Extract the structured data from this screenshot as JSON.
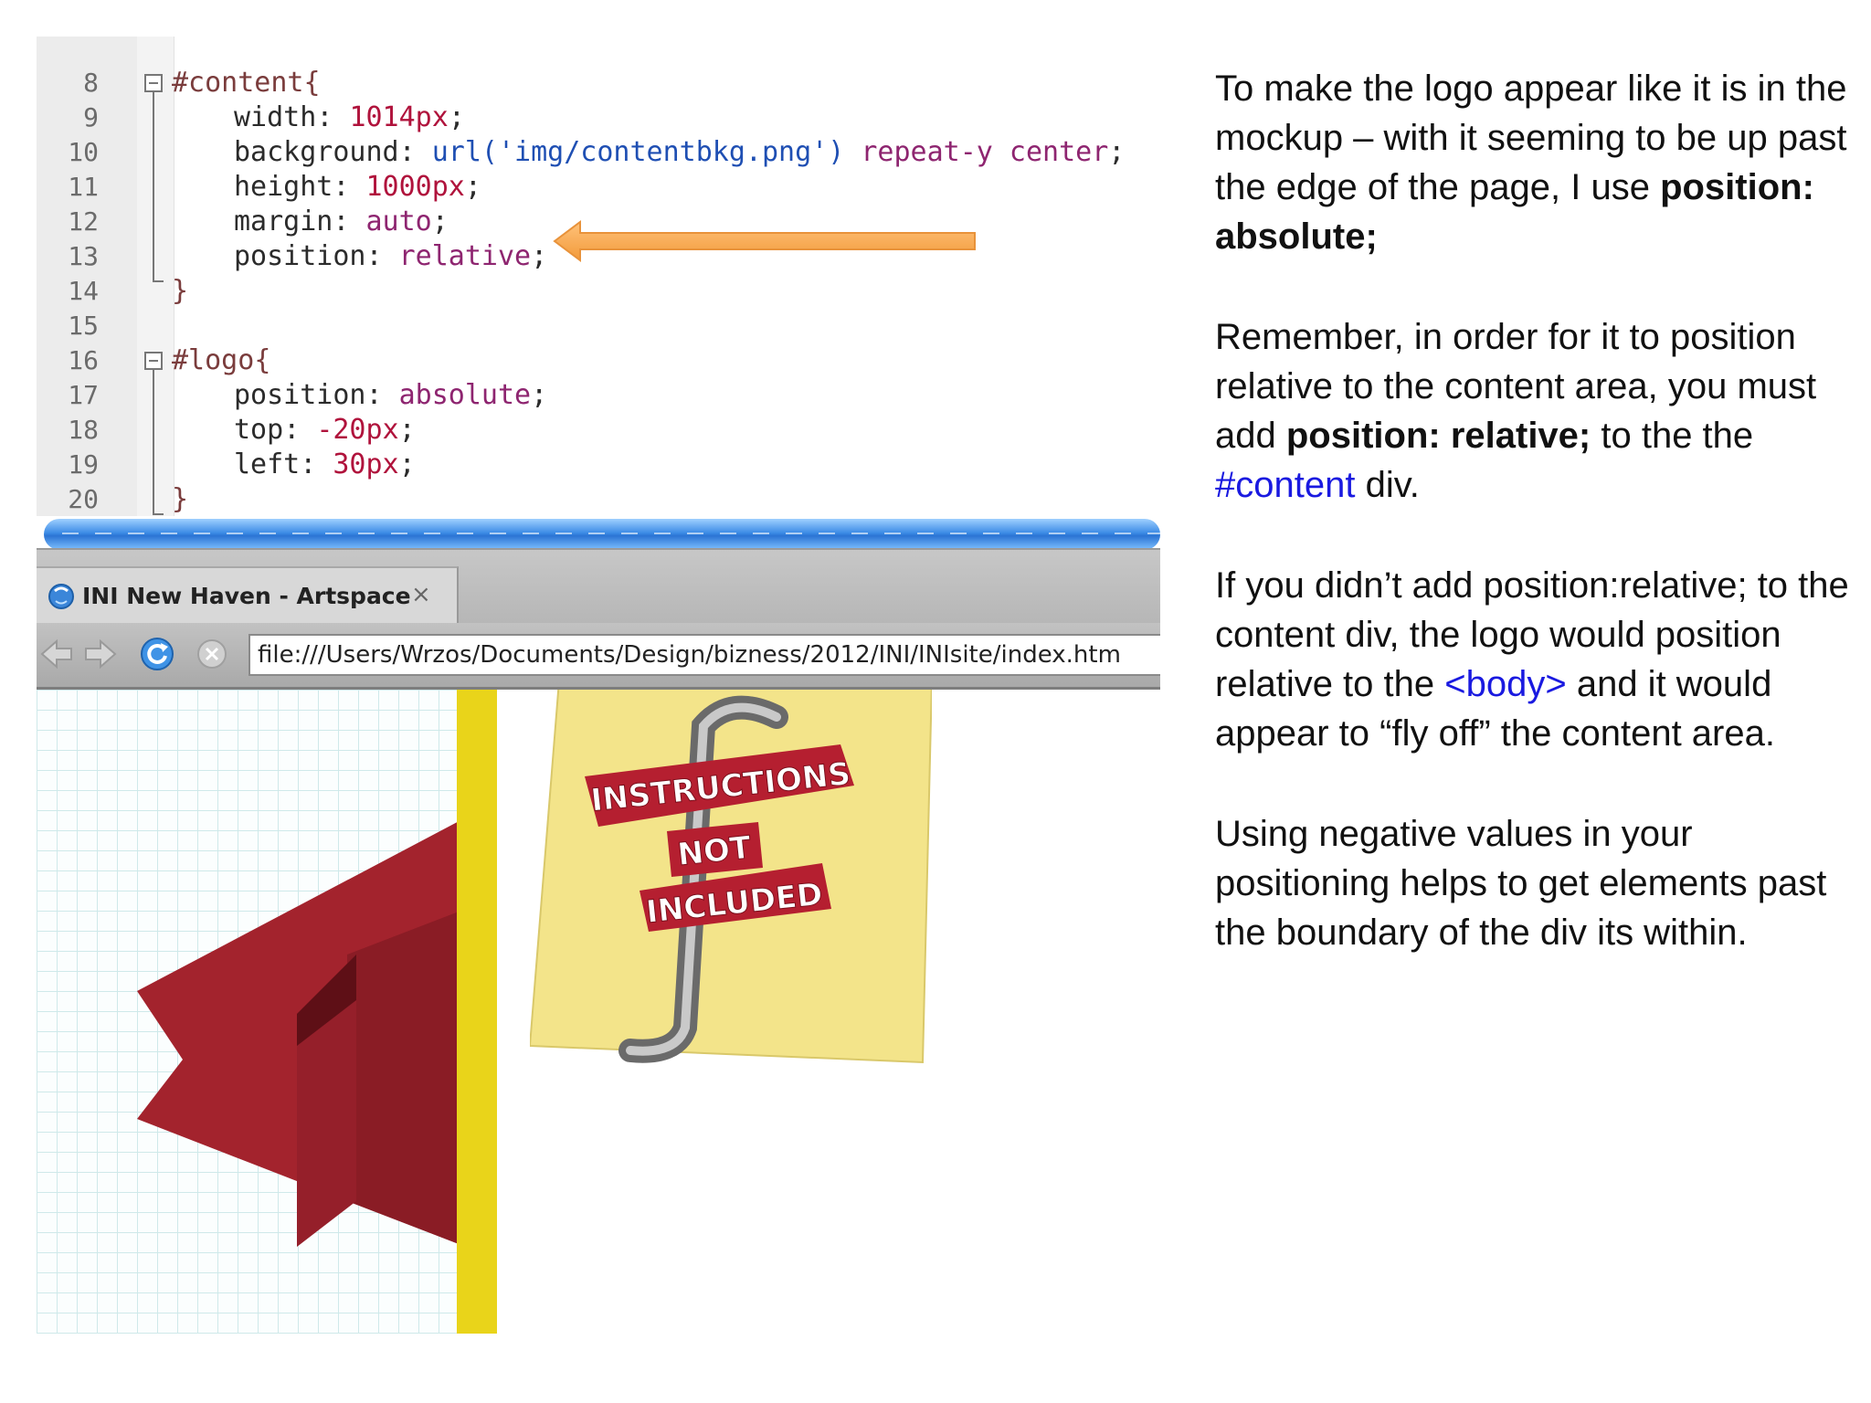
{
  "editor": {
    "line_numbers": [
      "8",
      "9",
      "10",
      "11",
      "12",
      "13",
      "14",
      "15",
      "16",
      "17",
      "18",
      "19",
      "20"
    ],
    "lines": {
      "l8": {
        "selector": "#content",
        "open": "{"
      },
      "l9": {
        "prop": "width",
        "sep": ": ",
        "value": "1014px",
        "end": ";"
      },
      "l10": {
        "prop": "background",
        "sep": ": ",
        "str": "url('img/contentbkg.png')",
        "rest": " repeat-y center",
        "end": ";"
      },
      "l11": {
        "prop": "height",
        "sep": ": ",
        "value": "1000px",
        "end": ";"
      },
      "l12": {
        "prop": "margin",
        "sep": ": ",
        "value": "auto",
        "end": ";"
      },
      "l13": {
        "prop": "position",
        "sep": ": ",
        "value": "relative",
        "end": ";"
      },
      "l14": {
        "close": "}"
      },
      "l16": {
        "selector": "#logo",
        "open": "{"
      },
      "l17": {
        "prop": "position",
        "sep": ": ",
        "value": "absolute",
        "end": ";"
      },
      "l18": {
        "prop": "top",
        "sep": ": ",
        "value": "-20px",
        "end": ";"
      },
      "l19": {
        "prop": "left",
        "sep": ": ",
        "value": "30px",
        "end": ";"
      },
      "l20": {
        "close": "}"
      }
    },
    "arrow_color": "#f5a94a"
  },
  "browser": {
    "tab_title": "INI New Haven - Artspace",
    "tab_close": "×",
    "url": "file:///Users/Wrzos/Documents/Design/bizness/2012/INI/INIsite/index.htm"
  },
  "logo_text": [
    "INSTRUCTIONS",
    "NOT",
    "INCLUDED"
  ],
  "panel": {
    "p1": {
      "text": "To make the logo appear like it is in the mockup – with it seeming to be up past the edge of the page, I use ",
      "bold": "position: absolute;"
    },
    "p2": {
      "text": "Remember, in order for it to position relative to the content area, you must add ",
      "bold": "position: relative;",
      "after": " to the the ",
      "link": "#content",
      "end": " div."
    },
    "p3": {
      "text": "If you didn’t add position:relative; to the content div, the logo would position relative to the ",
      "link": "<body>",
      "after": " and it would appear to “fly off” the content area."
    },
    "p4": {
      "text": "Using negative values in your positioning helps to get elements past the boundary of the div its within."
    }
  },
  "colors": {
    "link_blue": "#1a1ae0",
    "ribbon_red": "#8e1f2a",
    "note_yellow": "#f3e48a",
    "progress_blue": "#3d8ce6"
  }
}
